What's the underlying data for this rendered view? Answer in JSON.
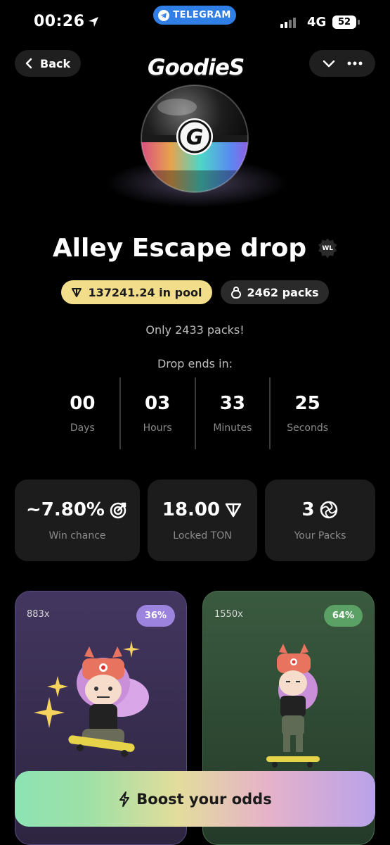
{
  "status_bar": {
    "time": "00:26",
    "telegram_label": "TELEGRAM",
    "network": "4G",
    "battery": "52"
  },
  "nav": {
    "back_label": "Back"
  },
  "logo": "GoodieS",
  "orb_letter": "G",
  "title": "Alley Escape drop",
  "wl_badge": "WL",
  "pool": "137241.24 in pool",
  "packs": "2462 packs",
  "only_packs": "Only 2433 packs!",
  "drop_ends_label": "Drop ends in:",
  "countdown": [
    {
      "value": "00",
      "label": "Days"
    },
    {
      "value": "03",
      "label": "Hours"
    },
    {
      "value": "33",
      "label": "Minutes"
    },
    {
      "value": "25",
      "label": "Seconds"
    }
  ],
  "stats": [
    {
      "value": "~7.80%",
      "label": "Win chance",
      "icon": "target-icon"
    },
    {
      "value": "18.00",
      "label": "Locked TON",
      "icon": "ton-icon"
    },
    {
      "value": "3",
      "label": "Your Packs",
      "icon": "pack-icon"
    }
  ],
  "cards": [
    {
      "multiplier": "883x",
      "percent": "36%",
      "theme": "#433660"
    },
    {
      "multiplier": "1550x",
      "percent": "64%",
      "theme": "#3a5a3f"
    }
  ],
  "boost_label": "Boost your odds",
  "colors": {
    "accent_pool": "#f2dd8b",
    "telegram_blue": "#2f7fe6",
    "purple_badge": "#9c83dd",
    "green_badge": "#5ba064"
  }
}
